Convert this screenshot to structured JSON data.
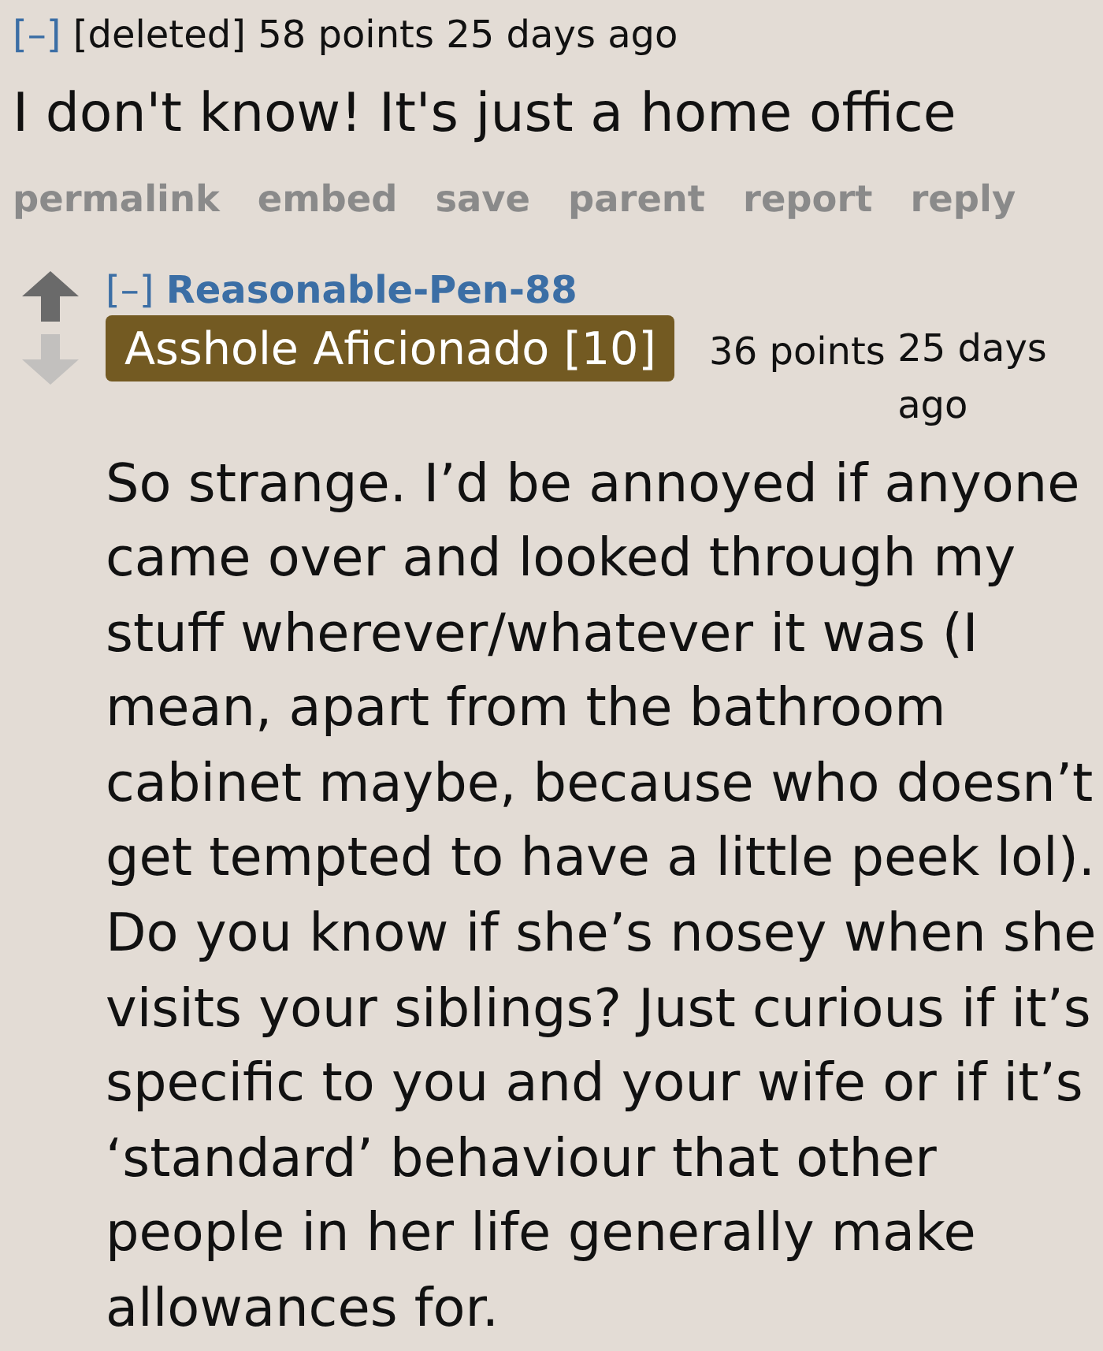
{
  "comments": [
    {
      "kind": "deleted",
      "collapse_toggle": "[–]",
      "author": "[deleted]",
      "score": "58 points",
      "time": "25 days ago",
      "body": "I don't know! It's just a home office",
      "buttons": [
        "permalink",
        "embed",
        "save",
        "parent",
        "report",
        "reply"
      ],
      "children": [
        {
          "kind": "user",
          "collapse_toggle": "[–]",
          "author": "Reasonable-Pen-88",
          "flair": "Asshole Aficionado [10]",
          "score": "36 points",
          "time": "25 days ago",
          "body": "So strange. I’d be annoyed if anyone came over and looked through my stuff wherever/whatever it was (I mean, apart from the bathroom cabinet maybe, because who doesn’t get tempted to have a little peek lol). Do you know if she’s nosey when she visits your siblings? Just curious if it’s specific to you and your wife or if it’s ‘standard’ behaviour that other people in her life generally make allowances for."
        }
      ]
    }
  ]
}
